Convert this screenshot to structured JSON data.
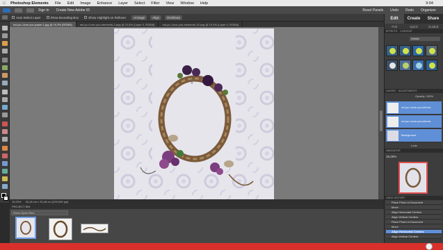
{
  "menubar": {
    "app": "Photoshop Elements",
    "items": [
      "File",
      "Edit",
      "Image",
      "Enhance",
      "Layer",
      "Select",
      "Filter",
      "View",
      "Window",
      "Help"
    ],
    "clock": "9:04"
  },
  "appbar": {
    "signin": "Sign In",
    "create_id": "Create New Adobe ID",
    "reset": "Reset Panels",
    "undo": "Undo",
    "redo": "Redo",
    "organizer": "Organizer"
  },
  "options": {
    "auto_select": "Auto Select Layer",
    "bounding_box": "Show Bounding Box",
    "highlight": "Show Highlight on Rollover",
    "arrange": "Arrange",
    "align": "Align",
    "distribute": "Distribute"
  },
  "tabs": [
    {
      "label": "md-pc-i-love-you-paper-1.jpg @ 19,3% (RGB/8)",
      "active": true
    },
    {
      "label": "md-pc-i-love-you-elements-2.png @ 31,6% (Layer 0, RGB/8)",
      "active": false
    },
    {
      "label": "md-pc-i-love-you-elements-15.png @ 19,3% (Layer 0, RGB/8)",
      "active": false
    }
  ],
  "status": {
    "zoom": "19,29%",
    "docsize": "30,48 cm x 30,48 cm (299,999 ppi)"
  },
  "project_bin": {
    "title": "PROJECT BIN",
    "select": "Show Open Files"
  },
  "right_panel": {
    "tabs": [
      "Edit",
      "Create",
      "Share"
    ],
    "subtabs": [
      "Full",
      "Quick",
      "Guided"
    ],
    "effects_header": "EFFECTS",
    "content_header": "CONTENT",
    "effects_select": "Artistic",
    "layers_header": "LAYERS",
    "adjustments_header": "ADJUSTMENTS",
    "opacity_label": "Opacity:",
    "opacity_value": "100%",
    "layers": [
      {
        "name": "md-pc-i-love-you-eleme.."
      },
      {
        "name": "md-pc-i-love-you-eleme.."
      },
      {
        "name": "Background"
      }
    ],
    "lock_label": "Lock:",
    "navigator_header": "NAVIGATOR",
    "navigator_zoom": "19,29%",
    "history_header": "UNDO HISTORY",
    "history": [
      {
        "label": "Place Photo in Document",
        "selected": false
      },
      {
        "label": "Move",
        "selected": false
      },
      {
        "label": "Align Horizontal Centers",
        "selected": false
      },
      {
        "label": "Align Vertical Centers",
        "selected": false
      },
      {
        "label": "Place Photo in Document",
        "selected": false
      },
      {
        "label": "Move",
        "selected": false
      },
      {
        "label": "Align Horizontal Centers",
        "selected": true
      },
      {
        "label": "Align Vertical Centers",
        "selected": false
      }
    ]
  },
  "colors": {
    "accent_blue": "#5f8fd6",
    "taskbar_red": "#d9302b",
    "canvas_gray": "#7a7a7a"
  }
}
